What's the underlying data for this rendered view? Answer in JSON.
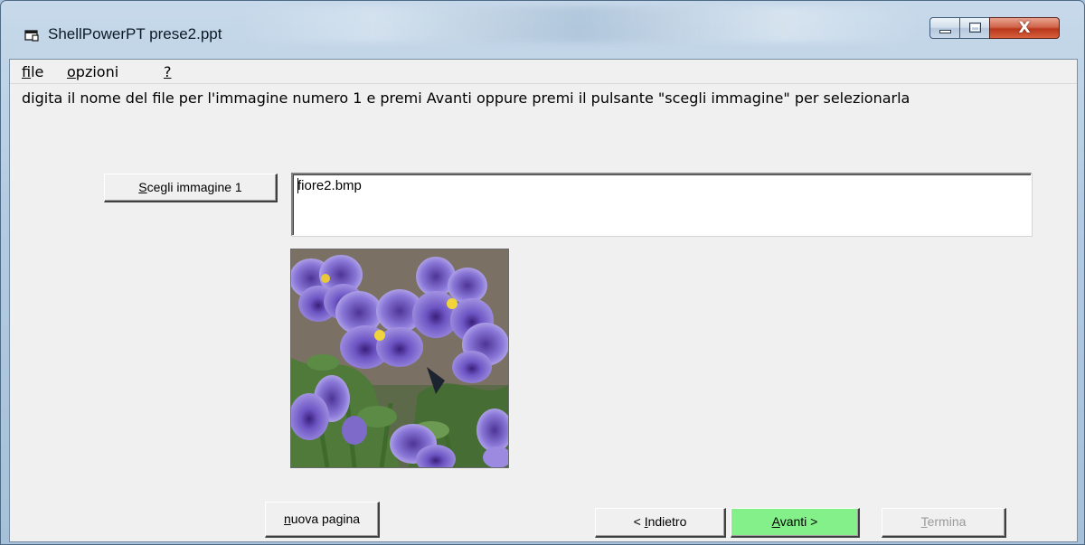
{
  "window": {
    "title": "ShellPowerPT prese2.ppt",
    "caption_buttons": {
      "minimize": "minimize",
      "maximize": "maximize",
      "close": "X"
    }
  },
  "menu": {
    "items": [
      {
        "label": "file",
        "accel": "f",
        "rest": "ile"
      },
      {
        "label": "opzioni",
        "accel": "o",
        "rest": "pzioni"
      },
      {
        "label": "?",
        "accel": "?",
        "rest": ""
      }
    ]
  },
  "instruction": "digita il nome del file per l'immagine  numero 1 e premi Avanti oppure premi il pulsante \"scegli immagine\" per selezionarla",
  "chooser": {
    "button_accel": "S",
    "button_rest": "cegli immagine 1",
    "filename": "fiore2.bmp"
  },
  "preview": {
    "icon": "pansy-flowers-image"
  },
  "footer": {
    "new_page": {
      "accel": "n",
      "rest": "uova pagina"
    },
    "back": {
      "prefix": "< ",
      "accel": "I",
      "rest": "ndietro"
    },
    "next": {
      "accel": "A",
      "rest": "vanti >"
    },
    "finish": {
      "accel": "T",
      "rest": "ermina",
      "enabled": false
    }
  },
  "colors": {
    "next_button": "#84f08a",
    "close_button": "#c94a2c",
    "client_bg": "#f0f0f0"
  }
}
